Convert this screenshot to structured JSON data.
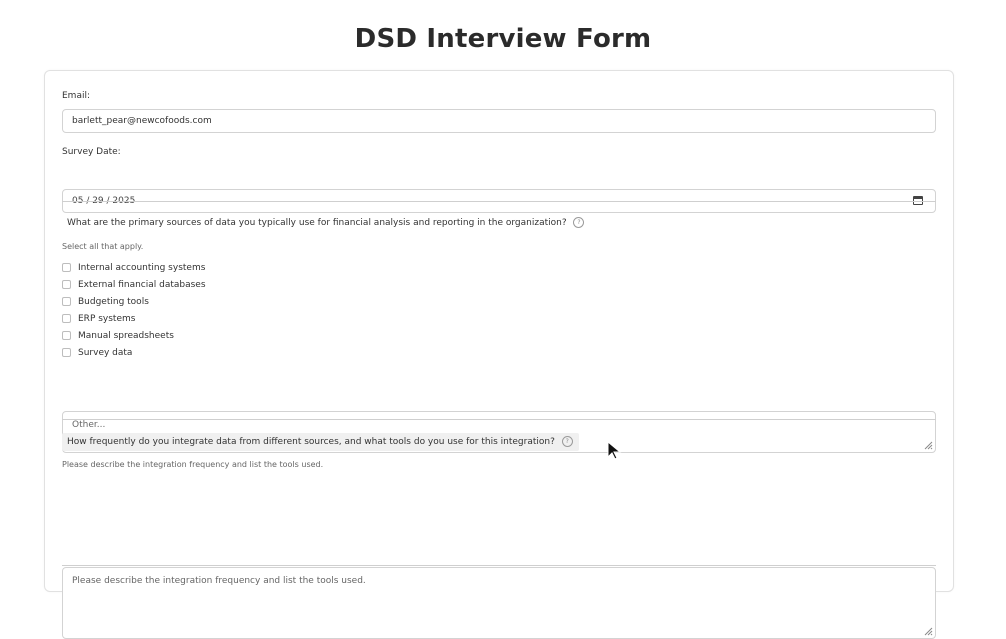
{
  "page": {
    "title": "DSD Interview Form"
  },
  "form": {
    "email": {
      "label": "Email:",
      "value": "barlett_pear@newcofoods.com"
    },
    "survey_date": {
      "label": "Survey Date:",
      "value": "05 / 29 / 2025"
    },
    "question1": {
      "text": "What are the primary sources of data you typically use for financial analysis and reporting in the organization?",
      "hint": "Select all that apply.",
      "options": [
        "Internal accounting systems",
        "External financial databases",
        "Budgeting tools",
        "ERP systems",
        "Manual spreadsheets",
        "Survey data"
      ],
      "other_placeholder": "Other..."
    },
    "question2": {
      "text": "How frequently do you integrate data from different sources, and what tools do you use for this integration?",
      "hint": "Please describe the integration frequency and list the tools used.",
      "placeholder": "Please describe the integration frequency and list the tools used."
    }
  },
  "icons": {
    "help": "question-circle-icon",
    "calendar": "calendar-icon",
    "resize": "resize-handle-icon",
    "cursor": "mouse-pointer-icon"
  }
}
